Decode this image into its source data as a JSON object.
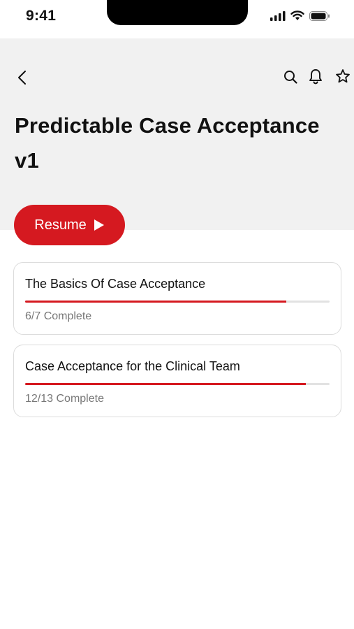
{
  "status_bar": {
    "time": "9:41"
  },
  "header": {
    "title": "Predictable Case Acceptance v1"
  },
  "resume": {
    "label": "Resume"
  },
  "colors": {
    "accent": "#d51920",
    "header_bg": "#f1f1f1",
    "muted_text": "#777777"
  },
  "icons": [
    "back-icon",
    "search-icon",
    "bell-icon",
    "star-icon",
    "play-icon"
  ],
  "modules": [
    {
      "title": "The Basics Of Case Acceptance",
      "status": "6/7 Complete",
      "progress": 0.857
    },
    {
      "title": "Case Acceptance for the Clinical Team",
      "status": "12/13 Complete",
      "progress": 0.923
    }
  ]
}
